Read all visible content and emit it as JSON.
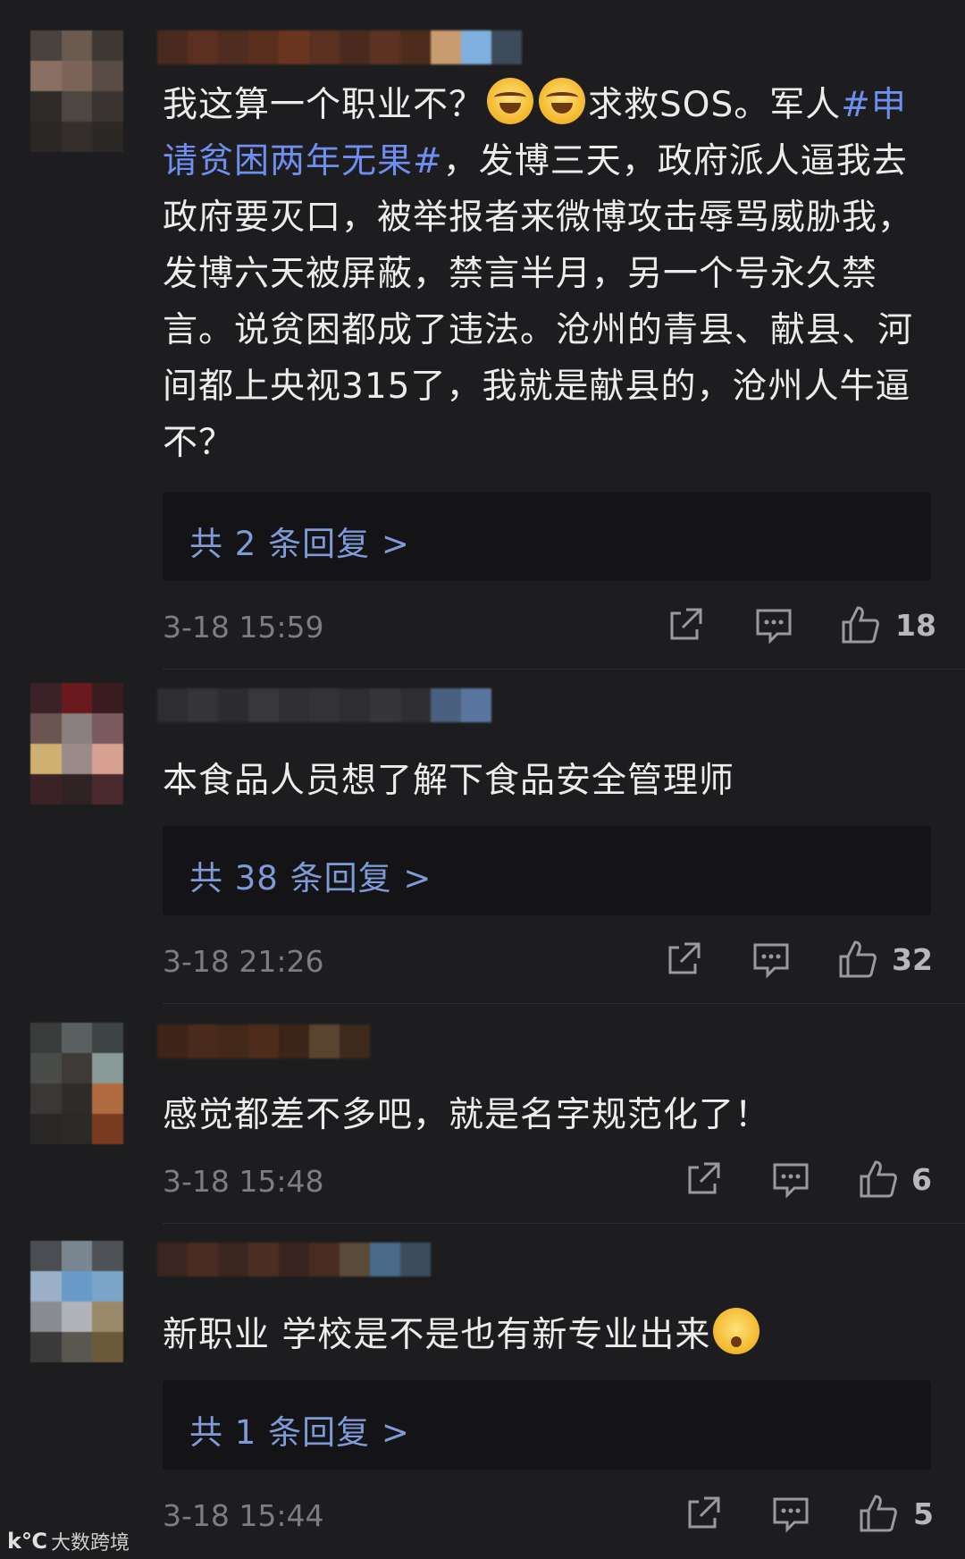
{
  "comments": [
    {
      "text_before": "我这算一个职业不？",
      "emoji1": "sob-emoji",
      "emoji2": "sob-emoji",
      "text_mid": "求救SOS。军人",
      "hashtag": "#申请贫困两年无果#",
      "text_after": "，发博三天，政府派人逼我去政府要灭口，被举报者来微博攻击辱骂威胁我，发博六天被屏蔽，禁言半月，另一个号永久禁言。说贫困都成了违法。沧州的青县、献县、河间都上央视315了，我就是献县的，沧州人牛逼不？",
      "reply_label": "共 2 条回复 >",
      "time": "3-18 15:59",
      "likes": "18"
    },
    {
      "text": "本食品人员想了解下食品安全管理师",
      "reply_label": "共 38 条回复 >",
      "time": "3-18 21:26",
      "likes": "32"
    },
    {
      "text": "感觉都差不多吧，就是名字规范化了！",
      "time": "3-18 15:48",
      "likes": "6"
    },
    {
      "text": "新职业  学校是不是也有新专业出来",
      "emoji": "thinking-emoji",
      "reply_label": "共 1 条回复 >",
      "time": "3-18 15:44",
      "likes": "5"
    }
  ],
  "watermark": {
    "logo": "k℃",
    "text": "大数跨境"
  },
  "colors": {
    "background": "#1d1d1f",
    "hashtag": "#6f8ff0",
    "reply": "#7e9ad8",
    "meta": "#7d7d80"
  }
}
